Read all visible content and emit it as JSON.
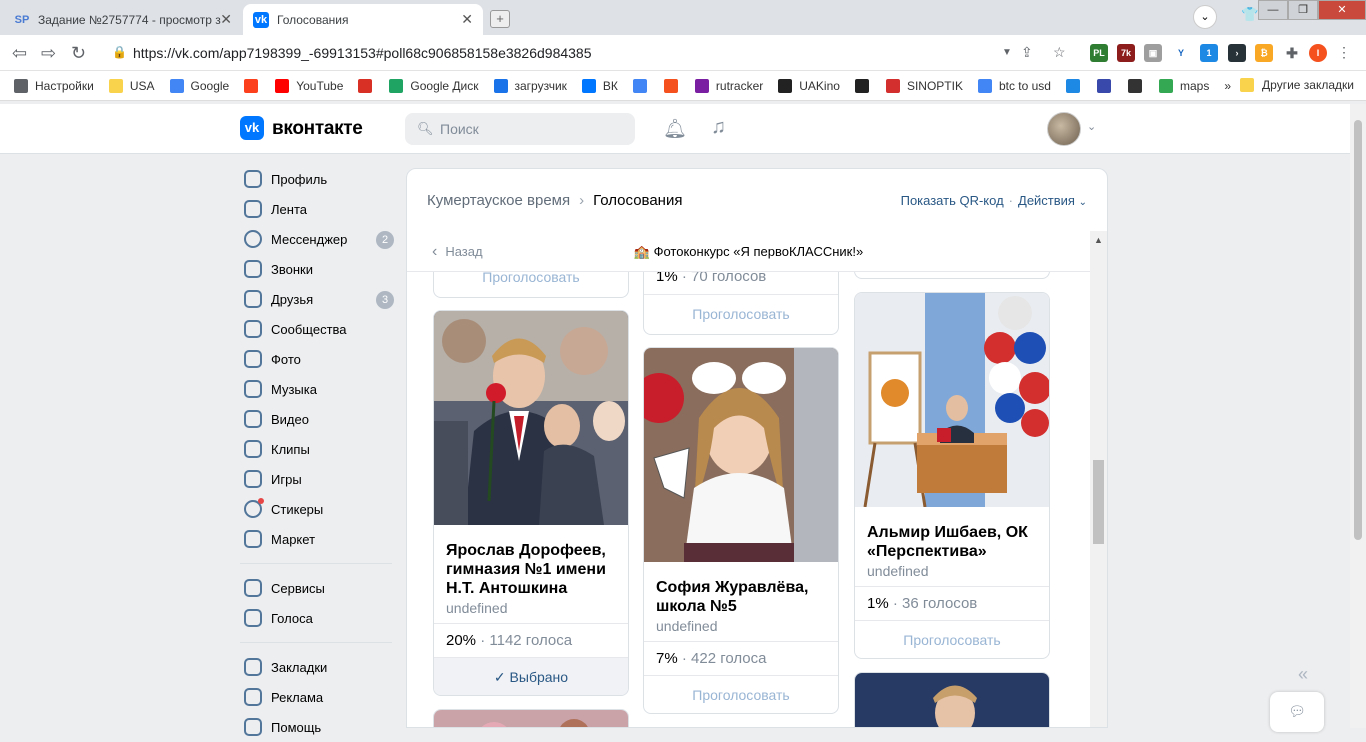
{
  "browser": {
    "tabs": [
      {
        "favicon": "SP",
        "title": "Задание №2757774 - просмотр з",
        "close": "✕"
      },
      {
        "favicon": "vk",
        "title": "Голосования",
        "close": "✕"
      }
    ],
    "new_tab": "+",
    "url": "https://vk.com/app7198399_-69913153#poll68c906858158e3826d984385",
    "window_controls": {
      "minimize": "—",
      "maximize": "❐",
      "close": "✕"
    },
    "bookmarks": [
      {
        "label": "Настройки",
        "icon": "gear-icon",
        "color": "#5f6368"
      },
      {
        "label": "USA",
        "icon": "folder-icon",
        "color": "#f9d34c"
      },
      {
        "label": "Google",
        "icon": "google-icon",
        "color": "#4285f4"
      },
      {
        "label": "",
        "icon": "yandex-icon",
        "color": "#fc3f1d"
      },
      {
        "label": "YouTube",
        "icon": "youtube-icon",
        "color": "#ff0000"
      },
      {
        "label": "",
        "icon": "gmail-icon",
        "color": "#d93025"
      },
      {
        "label": "Google Диск",
        "icon": "drive-icon",
        "color": "#1fa463"
      },
      {
        "label": "загрузчик",
        "icon": "loader-icon",
        "color": "#1a73e8"
      },
      {
        "label": "ВК",
        "icon": "vk-icon",
        "color": "#0077ff"
      },
      {
        "label": "",
        "icon": "translate-icon",
        "color": "#4285f4"
      },
      {
        "label": "",
        "icon": "f-icon",
        "color": "#f4511e"
      },
      {
        "label": "rutracker",
        "icon": "rutracker-icon",
        "color": "#7b1fa2"
      },
      {
        "label": "UAKino",
        "icon": "film-icon",
        "color": "#222222"
      },
      {
        "label": "",
        "icon": "chess-icon",
        "color": "#222222"
      },
      {
        "label": "SINOPTIK",
        "icon": "thermometer-icon",
        "color": "#d32f2f"
      },
      {
        "label": "btc to usd",
        "icon": "google-icon",
        "color": "#4285f4"
      },
      {
        "label": "",
        "icon": "p-icon",
        "color": "#1e88e5"
      },
      {
        "label": "",
        "icon": "arrow-icon",
        "color": "#3949ab"
      },
      {
        "label": "",
        "icon": "bc-icon",
        "color": "#333333"
      },
      {
        "label": "maps",
        "icon": "maps-icon",
        "color": "#34a853"
      }
    ],
    "bookmarks_more": "»",
    "other_bookmarks": "Другие закладки"
  },
  "vk": {
    "logo_text": "вконтакте",
    "search_placeholder": "Поиск",
    "accent": "#0077ff",
    "sidebar": [
      {
        "label": "Профиль",
        "badge": ""
      },
      {
        "label": "Лента",
        "badge": ""
      },
      {
        "label": "Мессенджер",
        "badge": "2"
      },
      {
        "label": "Звонки",
        "badge": ""
      },
      {
        "label": "Друзья",
        "badge": "3"
      },
      {
        "label": "Сообщества",
        "badge": ""
      },
      {
        "label": "Фото",
        "badge": ""
      },
      {
        "label": "Музыка",
        "badge": ""
      },
      {
        "label": "Видео",
        "badge": ""
      },
      {
        "label": "Клипы",
        "badge": ""
      },
      {
        "label": "Игры",
        "badge": ""
      },
      {
        "label": "Стикеры",
        "badge": ""
      },
      {
        "label": "Маркет",
        "badge": ""
      },
      {
        "label": "Сервисы",
        "badge": ""
      },
      {
        "label": "Голоса",
        "badge": ""
      },
      {
        "label": "Закладки",
        "badge": ""
      },
      {
        "label": "Реклама",
        "badge": ""
      },
      {
        "label": "Помощь",
        "badge": ""
      }
    ],
    "breadcrumb": {
      "parent": "Кумертауское время",
      "sep": "›",
      "current": "Голосования"
    },
    "qr_link": "Показать QR-код",
    "actions": "Действия",
    "back": "Назад",
    "poll_title": "🏫 Фотоконкурс «Я первоКЛАССник!»",
    "cards": {
      "col1_top": {
        "vote": "Проголосовать"
      },
      "col1": {
        "name": "Ярослав Дорофеев, гимназия №1 имени Н.Т. Антошкина",
        "note": "undefined",
        "percent": "20%",
        "votes": "1142 голоса",
        "action": "Выбрано"
      },
      "col2_top": {
        "percent": "1%",
        "votes": "70 голосов",
        "vote": "Проголосовать"
      },
      "col2": {
        "name": "София Журавлёва, школа №5",
        "note": "undefined",
        "percent": "7%",
        "votes": "422 голоса",
        "vote": "Проголосовать"
      },
      "col3": {
        "name": "Альмир Ишбаев, ОК «Перспектива»",
        "note": "undefined",
        "percent": "1%",
        "votes": "36 голосов",
        "vote": "Проголосовать"
      }
    }
  }
}
